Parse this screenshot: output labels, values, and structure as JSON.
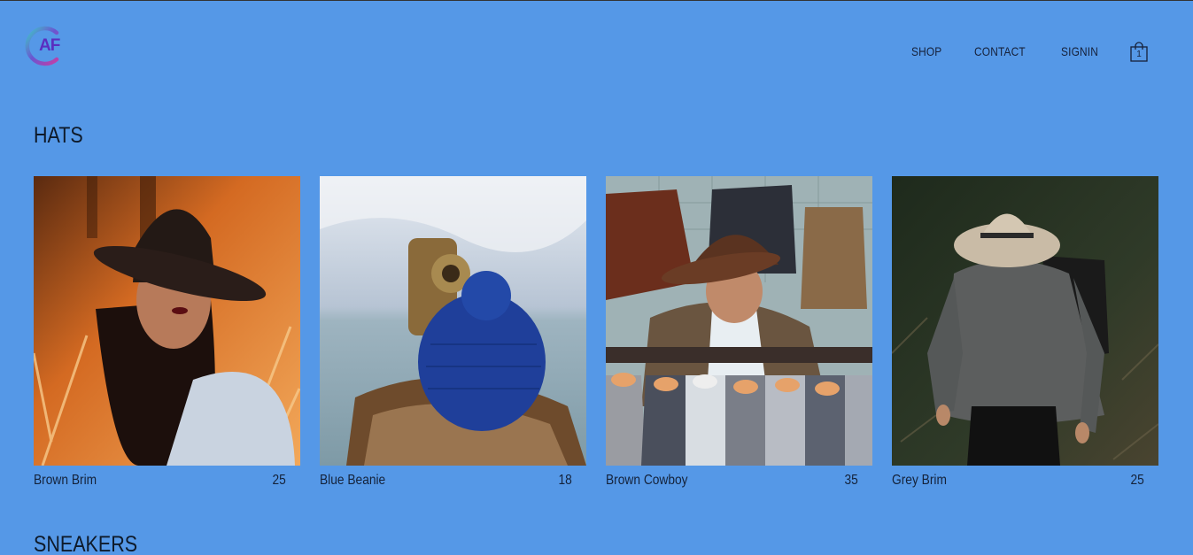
{
  "brand": {
    "logo_text": "AF"
  },
  "nav": {
    "items": [
      {
        "label": "SHOP"
      },
      {
        "label": "CONTACT"
      },
      {
        "label": "SIGNIN"
      }
    ],
    "cart_count": "1"
  },
  "sections": [
    {
      "title": "HATS",
      "items": [
        {
          "name": "Brown Brim",
          "price": "25"
        },
        {
          "name": "Blue Beanie",
          "price": "18"
        },
        {
          "name": "Brown Cowboy",
          "price": "35"
        },
        {
          "name": "Grey Brim",
          "price": "25"
        }
      ]
    },
    {
      "title": "SNEAKERS"
    }
  ],
  "colors": {
    "background": "#5598e7",
    "text": "#0e1a2a",
    "logo_purple": "#5a2ec0",
    "logo_teal": "#3fc6c9"
  }
}
